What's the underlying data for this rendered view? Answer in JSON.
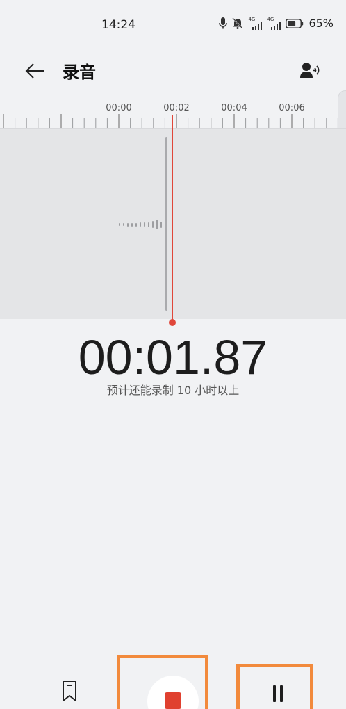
{
  "status_bar": {
    "time": "14:24",
    "network_1": "4G",
    "network_2": "4G",
    "battery": "65%",
    "battery_level": 0.65,
    "icons": [
      "mic-icon",
      "bell-mute-icon",
      "signal-icon",
      "signal-icon",
      "battery-icon"
    ]
  },
  "header": {
    "title": "录音",
    "back_icon": "arrow-left-icon",
    "voice_icon": "speaker-voice-icon"
  },
  "ruler": {
    "ticks": [
      "00:00",
      "00:02",
      "00:04",
      "00:06"
    ]
  },
  "timer": {
    "elapsed": "00:01.87",
    "hint": "预计还能录制 10 小时以上"
  },
  "controls": {
    "mark_icon": "bookmark-icon",
    "stop_icon": "stop-icon",
    "pause_icon": "pause-icon"
  },
  "colors": {
    "accent_red": "#e0473a",
    "highlight_orange": "#f28a3c",
    "background": "#f1f2f4",
    "wave_bg": "#e4e5e7"
  }
}
